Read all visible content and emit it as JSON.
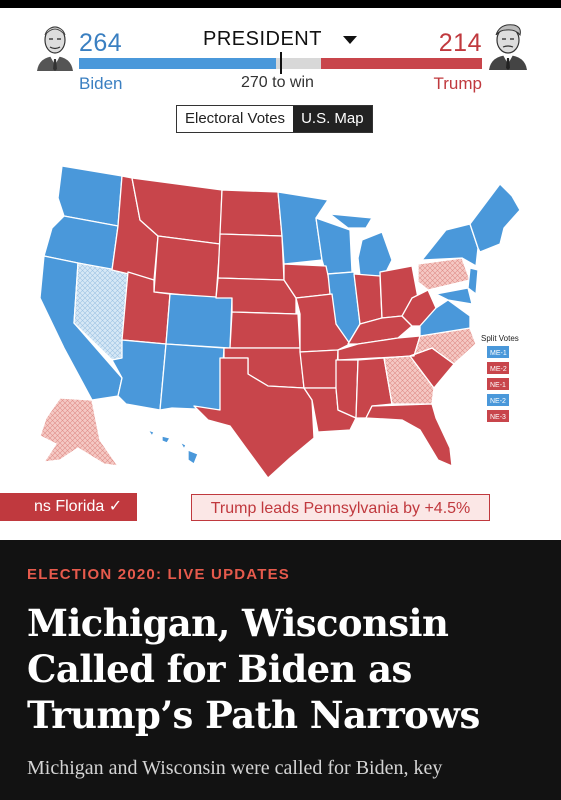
{
  "race": {
    "title": "PRESIDENT",
    "win_threshold": "270 to win",
    "biden": {
      "name": "Biden",
      "votes": "264",
      "color": "#3a7fc1"
    },
    "trump": {
      "name": "Trump",
      "votes": "214",
      "color": "#c0393e"
    },
    "bar": {
      "biden_ev": 264,
      "trump_ev": 214,
      "total_ev": 538
    }
  },
  "view_toggle": {
    "electoral_votes": "Electoral Votes",
    "us_map": "U.S. Map",
    "selected": "U.S. Map"
  },
  "map": {
    "split_votes_title": "Split Votes",
    "split_votes": [
      {
        "label": "ME-1",
        "party": "dem"
      },
      {
        "label": "ME-2",
        "party": "rep"
      },
      {
        "label": "NE-1",
        "party": "rep"
      },
      {
        "label": "NE-2",
        "party": "dem"
      },
      {
        "label": "NE-3",
        "party": "rep"
      }
    ],
    "colors": {
      "dem": "#4a98da",
      "rep": "#c8454b",
      "dem_lean": "#d6e8f6",
      "rep_lean": "#f5c9c4"
    }
  },
  "ticker": {
    "item1": "ns Florida ✓",
    "item2": "Trump leads Pennsylvania by +4.5%"
  },
  "article": {
    "kicker": "ELECTION 2020: LIVE UPDATES",
    "headline": "Michigan, Wisconsin Called for Biden as Trump’s Path Narrows",
    "dek": "Michigan and Wisconsin were called for Biden, key"
  }
}
